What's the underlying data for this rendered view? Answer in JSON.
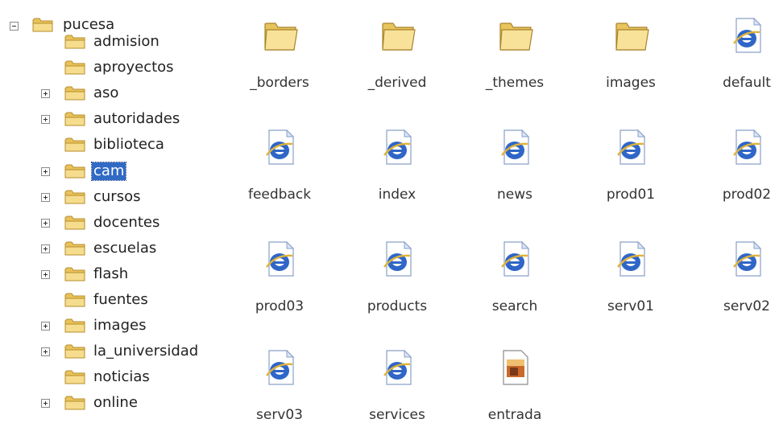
{
  "tree": {
    "root": {
      "label": "pucesa",
      "expander": "minus"
    },
    "items": [
      {
        "label": "admision",
        "expander": "none"
      },
      {
        "label": "aproyectos",
        "expander": "none"
      },
      {
        "label": "aso",
        "expander": "plus"
      },
      {
        "label": "autoridades",
        "expander": "plus"
      },
      {
        "label": "biblioteca",
        "expander": "none"
      },
      {
        "label": "cam",
        "expander": "plus",
        "selected": true
      },
      {
        "label": "cursos",
        "expander": "plus"
      },
      {
        "label": "docentes",
        "expander": "plus"
      },
      {
        "label": "escuelas",
        "expander": "plus"
      },
      {
        "label": "flash",
        "expander": "plus"
      },
      {
        "label": "fuentes",
        "expander": "none"
      },
      {
        "label": "images",
        "expander": "plus"
      },
      {
        "label": "la_universidad",
        "expander": "plus"
      },
      {
        "label": "noticias",
        "expander": "none"
      },
      {
        "label": "online",
        "expander": "plus"
      }
    ]
  },
  "files": [
    {
      "label": "_borders",
      "icon": "folder-icon"
    },
    {
      "label": "_derived",
      "icon": "folder-icon"
    },
    {
      "label": "_themes",
      "icon": "folder-icon"
    },
    {
      "label": "images",
      "icon": "folder-icon"
    },
    {
      "label": "default",
      "icon": "ie-document-icon"
    },
    {
      "label": "feedback",
      "icon": "ie-document-icon"
    },
    {
      "label": "index",
      "icon": "ie-document-icon"
    },
    {
      "label": "news",
      "icon": "ie-document-icon"
    },
    {
      "label": "prod01",
      "icon": "ie-document-icon"
    },
    {
      "label": "prod02",
      "icon": "ie-document-icon"
    },
    {
      "label": "prod03",
      "icon": "ie-document-icon"
    },
    {
      "label": "products",
      "icon": "ie-document-icon"
    },
    {
      "label": "search",
      "icon": "ie-document-icon"
    },
    {
      "label": "serv01",
      "icon": "ie-document-icon"
    },
    {
      "label": "serv02",
      "icon": "ie-document-icon"
    },
    {
      "label": "serv03",
      "icon": "ie-document-icon"
    },
    {
      "label": "services",
      "icon": "ie-document-icon"
    },
    {
      "label": "entrada",
      "icon": "image-file-icon"
    }
  ],
  "colors": {
    "selection": "#316ac5",
    "folder": "#f4d77b",
    "ie_blue": "#2f66c7"
  }
}
